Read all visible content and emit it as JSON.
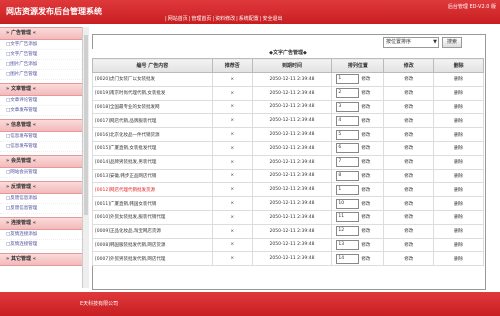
{
  "header": {
    "title": "网店资源发布后台管理系统",
    "version": "后台管理 ED-V2.0 版",
    "nav": [
      "网站首页",
      "管理首页",
      "资料修改",
      "系统配置",
      "安全退出"
    ]
  },
  "sidebar": {
    "groups": [
      {
        "title": "广告管理",
        "items": [
          "文字广告添加",
          "文字广告管理",
          "图片广告添加",
          "图片广告管理"
        ]
      },
      {
        "title": "文章管理",
        "items": [
          "文章评论管理",
          "文章发布管理"
        ]
      },
      {
        "title": "信息管理",
        "items": [
          "信息发布管理",
          "信息发布管理"
        ]
      },
      {
        "title": "会员管理",
        "items": [
          "网站会员管理"
        ]
      },
      {
        "title": "反馈管理",
        "items": [
          "反馈信息添加",
          "反馈信息管理"
        ]
      },
      {
        "title": "连接管理",
        "items": [
          "友情连接添加",
          "友情连接管理"
        ]
      },
      {
        "title": "其它管理",
        "items": []
      }
    ]
  },
  "toolbar": {
    "select_value": "按位置排序",
    "search_label": "搜索"
  },
  "table": {
    "caption": "文字广告管理",
    "headers": [
      "编号 广告内容",
      "推荐否",
      "到期时间",
      "排列位置",
      "修改",
      "删除"
    ],
    "rows": [
      {
        "title": "[0020]虎门女装厂以女装批发",
        "rec": "×",
        "time": "2050-12-11 2:39:48",
        "rank": "1",
        "btn": "修改",
        "edit": "修改",
        "del": "删除"
      },
      {
        "title": "[0019]南京时尚代理代销,女装批发",
        "rec": "×",
        "time": "2050-12-11 2:39:48",
        "rank": "2",
        "btn": "修改",
        "edit": "修改",
        "del": "删除"
      },
      {
        "title": "[0018]全国最专业的女装批发网",
        "rec": "×",
        "time": "2050-12-11 2:39:48",
        "rank": "3",
        "btn": "修改",
        "edit": "修改",
        "del": "删除"
      },
      {
        "title": "[0017]网店代销,品牌服装代理",
        "rec": "×",
        "time": "2050-12-11 2:39:48",
        "rank": "4",
        "btn": "修改",
        "edit": "修改",
        "del": "删除"
      },
      {
        "title": "[0016]北京化妆品一件代销货源",
        "rec": "×",
        "time": "2050-12-11 2:39:48",
        "rank": "5",
        "btn": "修改",
        "edit": "修改",
        "del": "删除"
      },
      {
        "title": "[0015]广厦直销,女装批发代理",
        "rec": "×",
        "time": "2050-12-11 2:39:48",
        "rank": "6",
        "btn": "修改",
        "edit": "修改",
        "del": "删除"
      },
      {
        "title": "[0014]品牌男装批发,男装代理",
        "rec": "×",
        "time": "2050-12-11 2:39:48",
        "rank": "7",
        "btn": "修改",
        "edit": "修改",
        "del": "删除"
      },
      {
        "title": "[0013]安徽,韩步正品网店代销",
        "rec": "×",
        "time": "2050-12-11 2:39:48",
        "rank": "8",
        "btn": "修改",
        "edit": "修改",
        "del": "删除"
      },
      {
        "title": "[0012]网店代理代销批发货源",
        "rec": "×",
        "time": "2050-12-11 2:39:48",
        "rank": "1",
        "btn": "修改",
        "edit": "修改",
        "del": "删除",
        "highlight": true
      },
      {
        "title": "[0011]广厦直销,韩国女装代销",
        "rec": "×",
        "time": "2050-12-11 2:39:48",
        "rank": "10",
        "btn": "修改",
        "edit": "修改",
        "del": "删除"
      },
      {
        "title": "[0010]外贸女装批发,服装代销代理",
        "rec": "×",
        "time": "2050-12-11 2:39:48",
        "rank": "11",
        "btn": "修改",
        "edit": "修改",
        "del": "删除"
      },
      {
        "title": "[0009]正品化妆品,淘宝网店货源",
        "rec": "×",
        "time": "2050-12-11 2:39:48",
        "rank": "12",
        "btn": "修改",
        "edit": "修改",
        "del": "删除"
      },
      {
        "title": "[0008]韩国服装批发代销,网店货源",
        "rec": "×",
        "time": "2050-12-11 2:39:48",
        "rank": "13",
        "btn": "修改",
        "edit": "修改",
        "del": "删除"
      },
      {
        "title": "[0007]外贸男装批发代销,网店代理",
        "rec": "×",
        "time": "2050-12-11 2:39:48",
        "rank": "14",
        "btn": "修改",
        "edit": "修改",
        "del": "删除"
      }
    ]
  },
  "footer": {
    "company": "E天科技有限公司"
  },
  "colors": {
    "brand": "#d42a2e",
    "sidebar_head": "#f5c4c4",
    "highlight_text": "#e02020"
  }
}
